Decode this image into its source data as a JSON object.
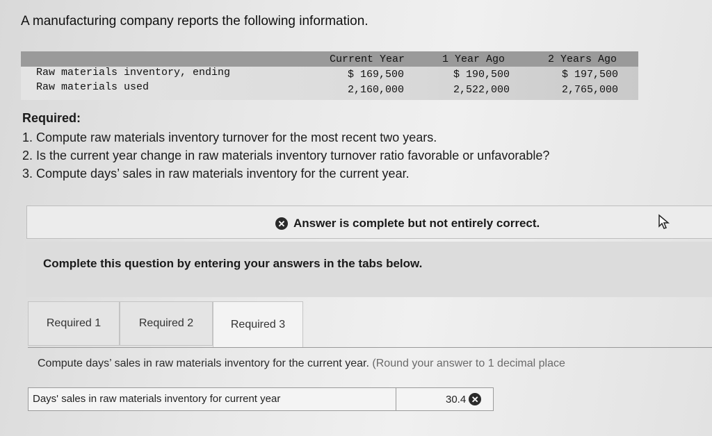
{
  "intro": "A manufacturing company reports the following information.",
  "table": {
    "headers": [
      "Current Year",
      "1 Year Ago",
      "2 Years Ago"
    ],
    "rows": [
      {
        "label": "Raw materials inventory, ending",
        "values": [
          "$ 169,500",
          "$ 190,500",
          "$ 197,500"
        ]
      },
      {
        "label": "Raw materials used",
        "values": [
          "2,160,000",
          "2,522,000",
          "2,765,000"
        ]
      }
    ]
  },
  "required": {
    "title": "Required:",
    "items": [
      "1. Compute raw materials inventory turnover for the most recent two years.",
      "2. Is the current year change in raw materials inventory turnover ratio favorable or unfavorable?",
      "3. Compute days’ sales in raw materials inventory for the current year."
    ]
  },
  "banner": {
    "message": "Answer is complete but not entirely correct.",
    "icon": "x-circle-icon"
  },
  "instructions": "Complete this question by entering your answers in the tabs below.",
  "tabs": [
    {
      "label": "Required 1",
      "active": false
    },
    {
      "label": "Required 2",
      "active": false
    },
    {
      "label": "Required 3",
      "active": true
    }
  ],
  "task": {
    "text": "Compute days’ sales in raw materials inventory for the current year.",
    "note": "(Round your answer to 1 decimal place"
  },
  "answer": {
    "label": "Days' sales in raw materials inventory for current year",
    "value": "30.4",
    "status_icon": "x-circle-icon"
  }
}
